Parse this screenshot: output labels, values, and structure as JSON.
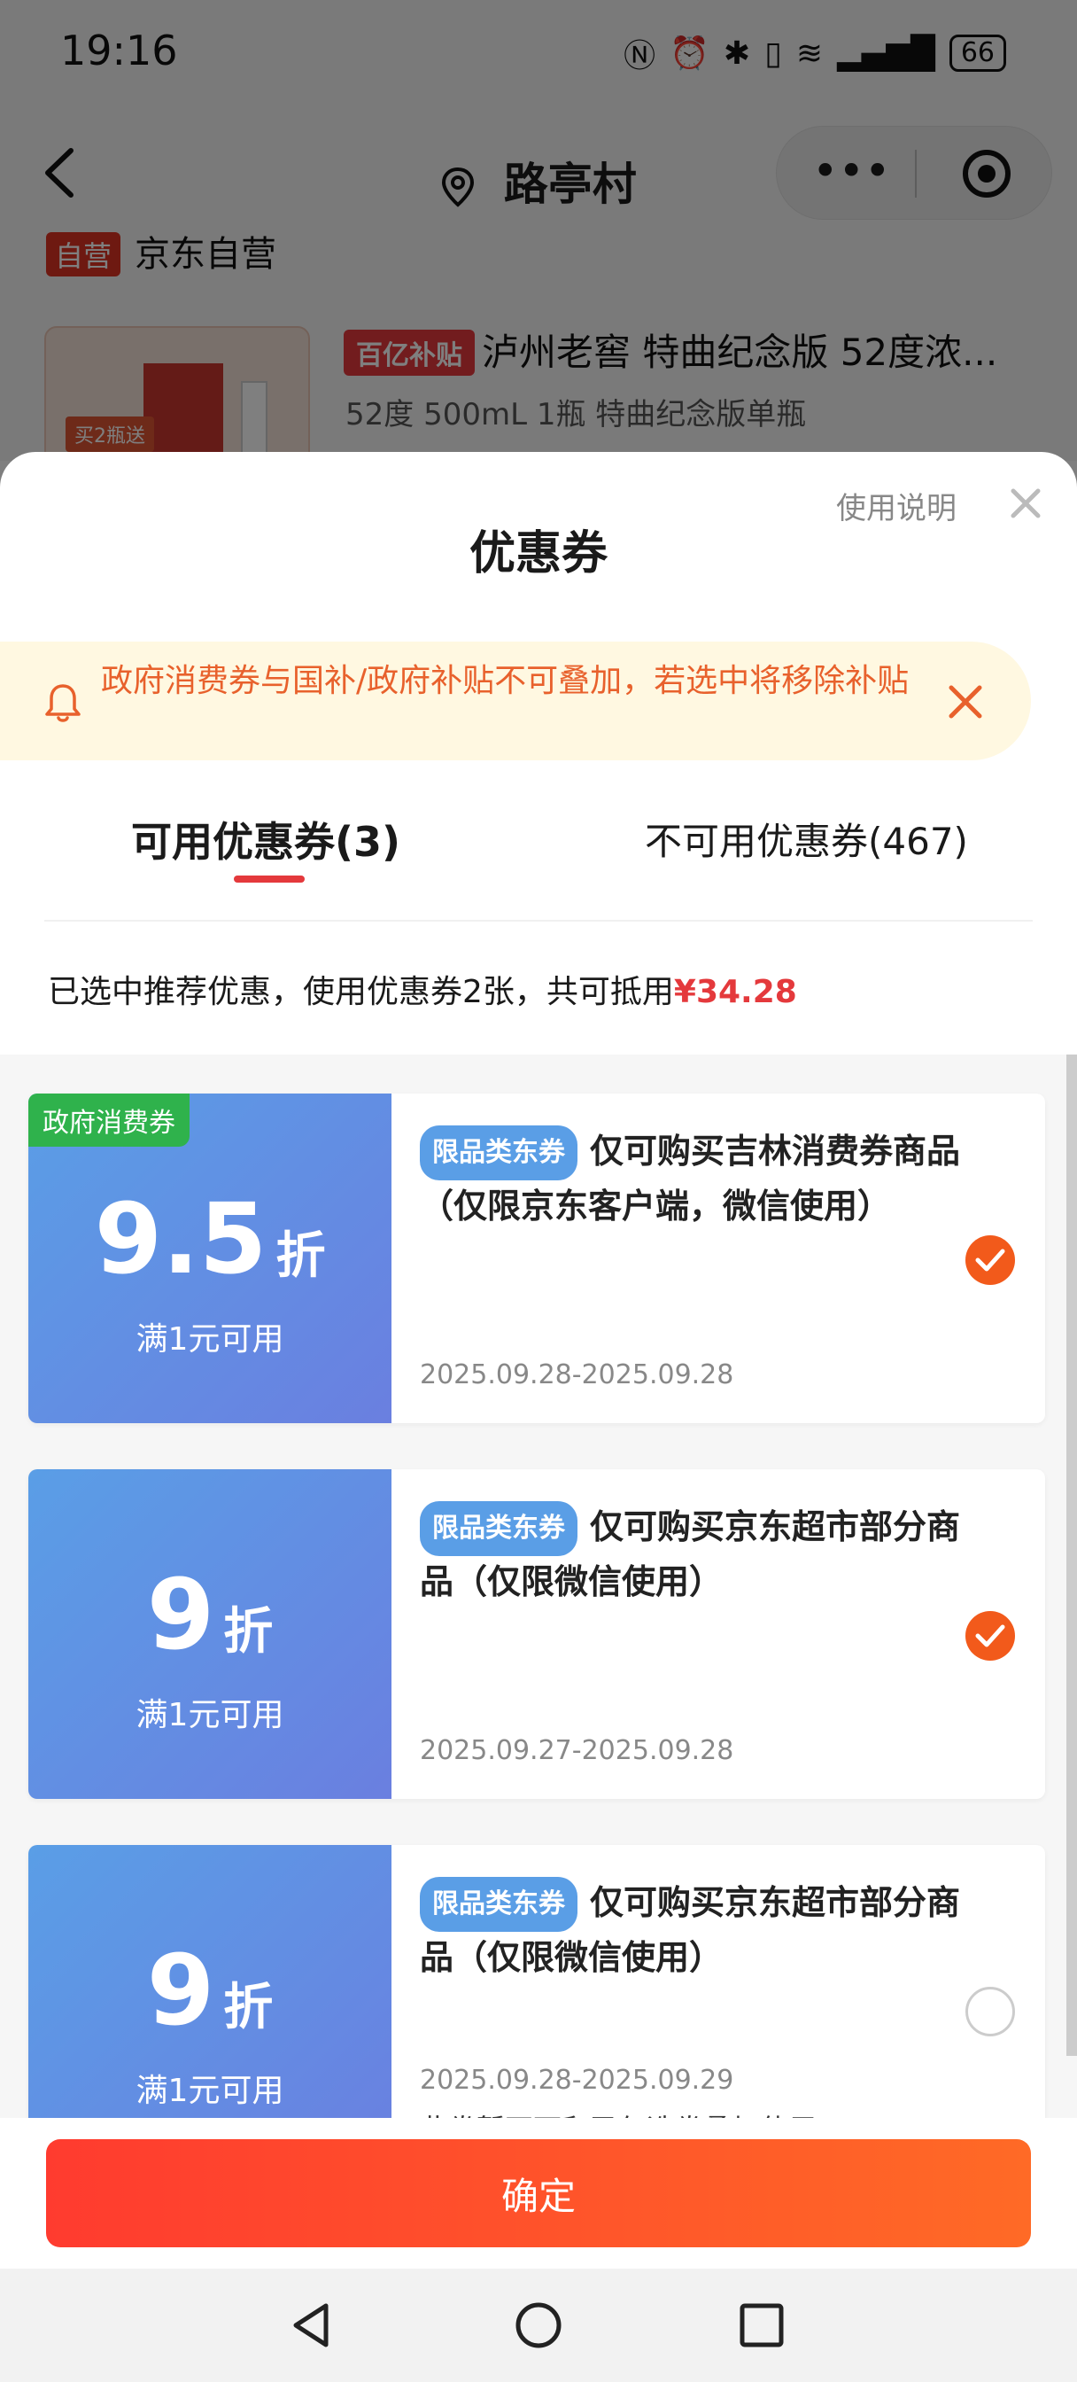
{
  "status_bar": {
    "time": "19:16",
    "icons": [
      "N",
      "⏰",
      "✱",
      "📳",
      "wifi",
      "signal"
    ],
    "battery": "66"
  },
  "nav": {
    "title": "路亭村"
  },
  "background": {
    "store_tag": "自营",
    "store_name": "京东自营",
    "product_badge": "百亿补贴",
    "product_title": "泸州老窖 特曲纪念版 52度浓...",
    "product_spec": "52度 500mL 1瓶 特曲纪念版单瓶",
    "product_image_label": "买2瓶送"
  },
  "sheet": {
    "help_link": "使用说明",
    "title": "优惠券",
    "notice": "政府消费券与国补/政府补贴不可叠加，若选中将移除补贴",
    "tabs": {
      "available": "可用优惠券(3)",
      "unavailable": "不可用优惠券(467)"
    },
    "summary": {
      "text": "已选中推荐优惠，使用优惠券2张，共可抵用",
      "amount": "¥34.28"
    }
  },
  "coupons": [
    {
      "gov_tag": "政府消费券",
      "discount": "9.5",
      "unit": "折",
      "condition": "满1元可用",
      "type_tag": "限品类东券",
      "description": "仅可购买吉林消费券商品（仅限京东客户端，微信使用）",
      "date": "2025.09.28-2025.09.28",
      "selected": true,
      "note": ""
    },
    {
      "gov_tag": "",
      "discount": "9",
      "unit": "折",
      "condition": "满1元可用",
      "type_tag": "限品类东券",
      "description": "仅可购买京东超市部分商品（仅限微信使用）",
      "date": "2025.09.27-2025.09.28",
      "selected": true,
      "note": ""
    },
    {
      "gov_tag": "",
      "discount": "9",
      "unit": "折",
      "condition": "满1元可用",
      "type_tag": "限品类东券",
      "description": "仅可购买京东超市部分商品（仅限微信使用）",
      "date": "2025.09.28-2025.09.29",
      "selected": false,
      "note": "此券暂不可和已勾选券叠加使用"
    }
  ],
  "footer": {
    "confirm_label": "确定"
  },
  "colors": {
    "accent": "#e4393c",
    "confirm_start": "#ff3b2f",
    "confirm_end": "#ff6a26",
    "coupon_blue": "#5a9ee6",
    "gov_green": "#2fb24c",
    "notice_bg": "#fff8e1",
    "notice_text": "#e8612c"
  }
}
